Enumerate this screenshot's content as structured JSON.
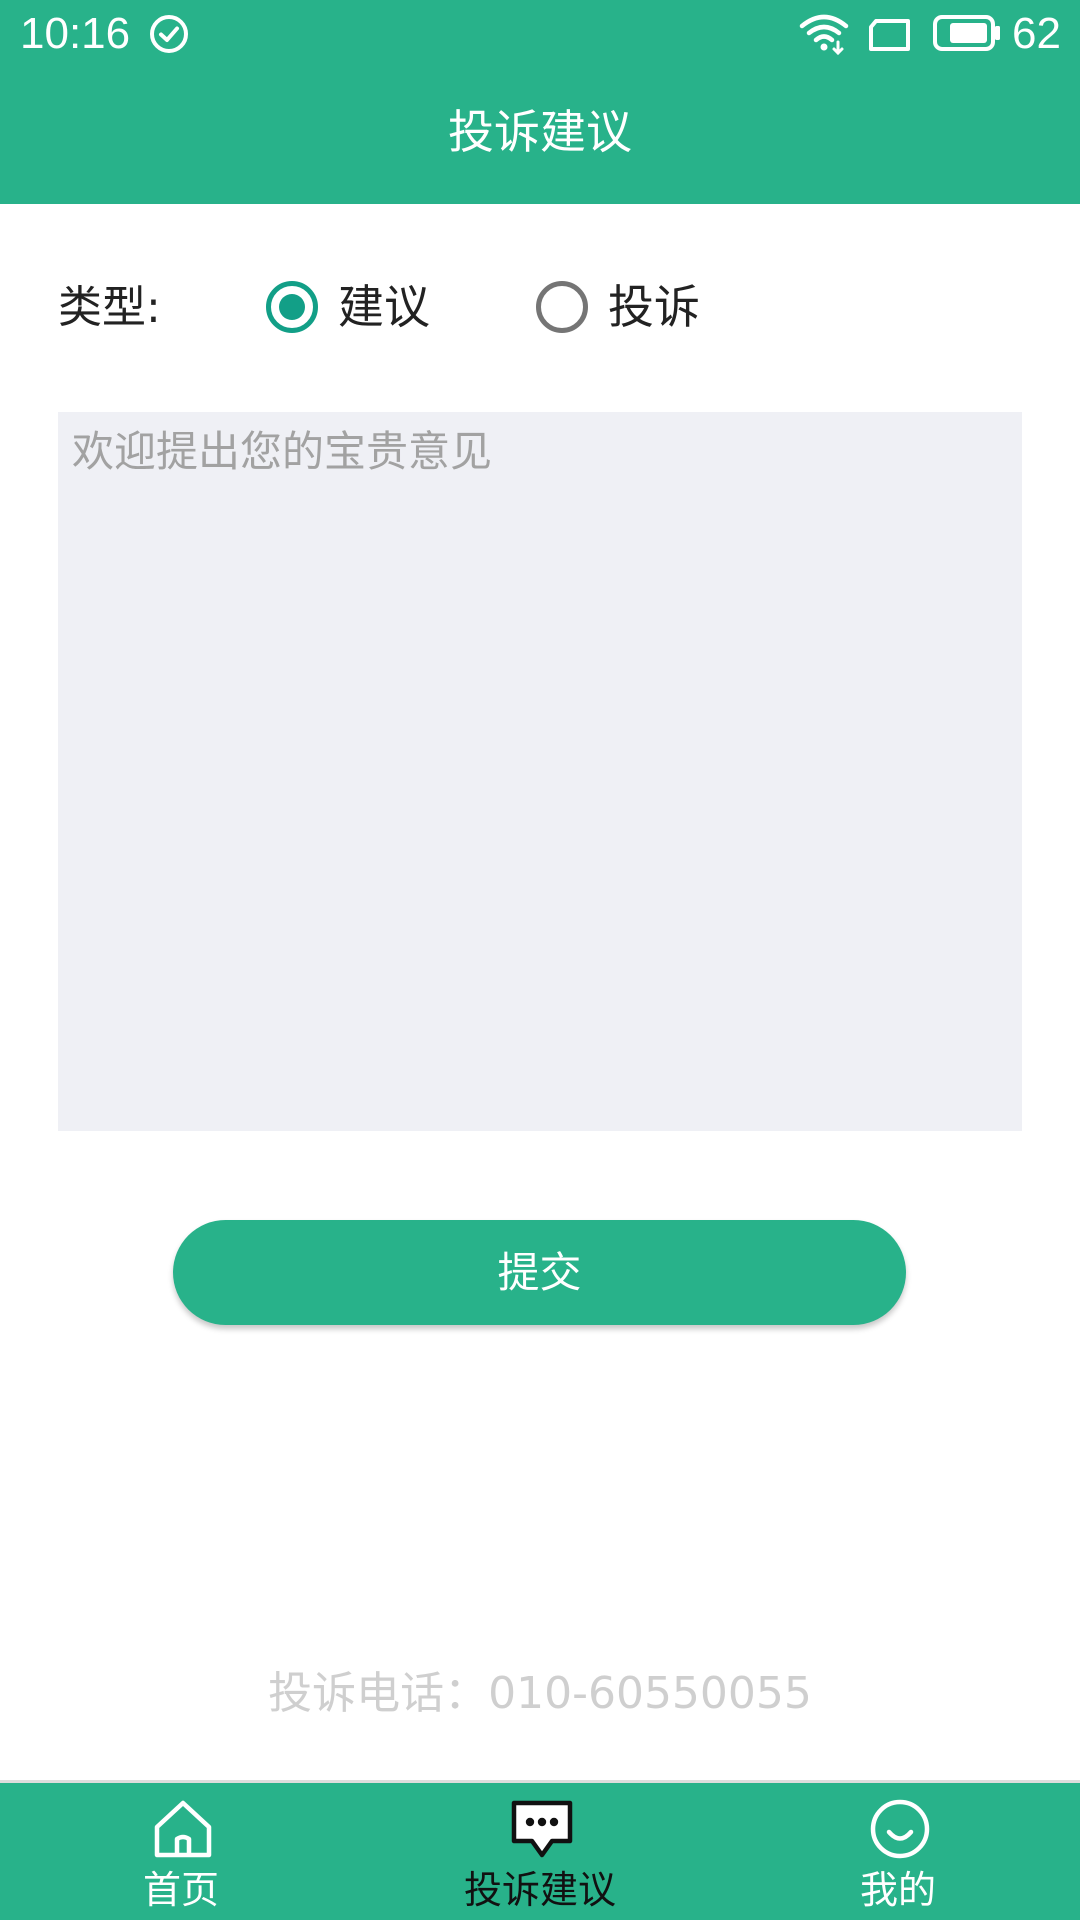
{
  "status_bar": {
    "time": "10:16",
    "battery_level": "62",
    "icons": [
      "check-circle-icon",
      "wifi-icon",
      "sim-card-icon",
      "battery-icon"
    ]
  },
  "header": {
    "title": "投诉建议"
  },
  "form": {
    "type_label": "类型:",
    "options": [
      {
        "label": "建议",
        "selected": true
      },
      {
        "label": "投诉",
        "selected": false
      }
    ],
    "feedback_placeholder": "欢迎提出您的宝贵意见",
    "feedback_value": "",
    "submit_label": "提交"
  },
  "hotline": "投诉电话：010-60550055",
  "bottom_nav": {
    "items": [
      {
        "label": "首页",
        "icon": "home-icon",
        "active": false
      },
      {
        "label": "投诉建议",
        "icon": "chat-bubble-icon",
        "active": true
      },
      {
        "label": "我的",
        "icon": "smiley-icon",
        "active": false
      }
    ]
  },
  "colors": {
    "brand_green": "#28b28a",
    "radio_selected": "#129f87",
    "textarea_bg": "#eff0f5",
    "hotline_text": "#cfcfcf"
  }
}
